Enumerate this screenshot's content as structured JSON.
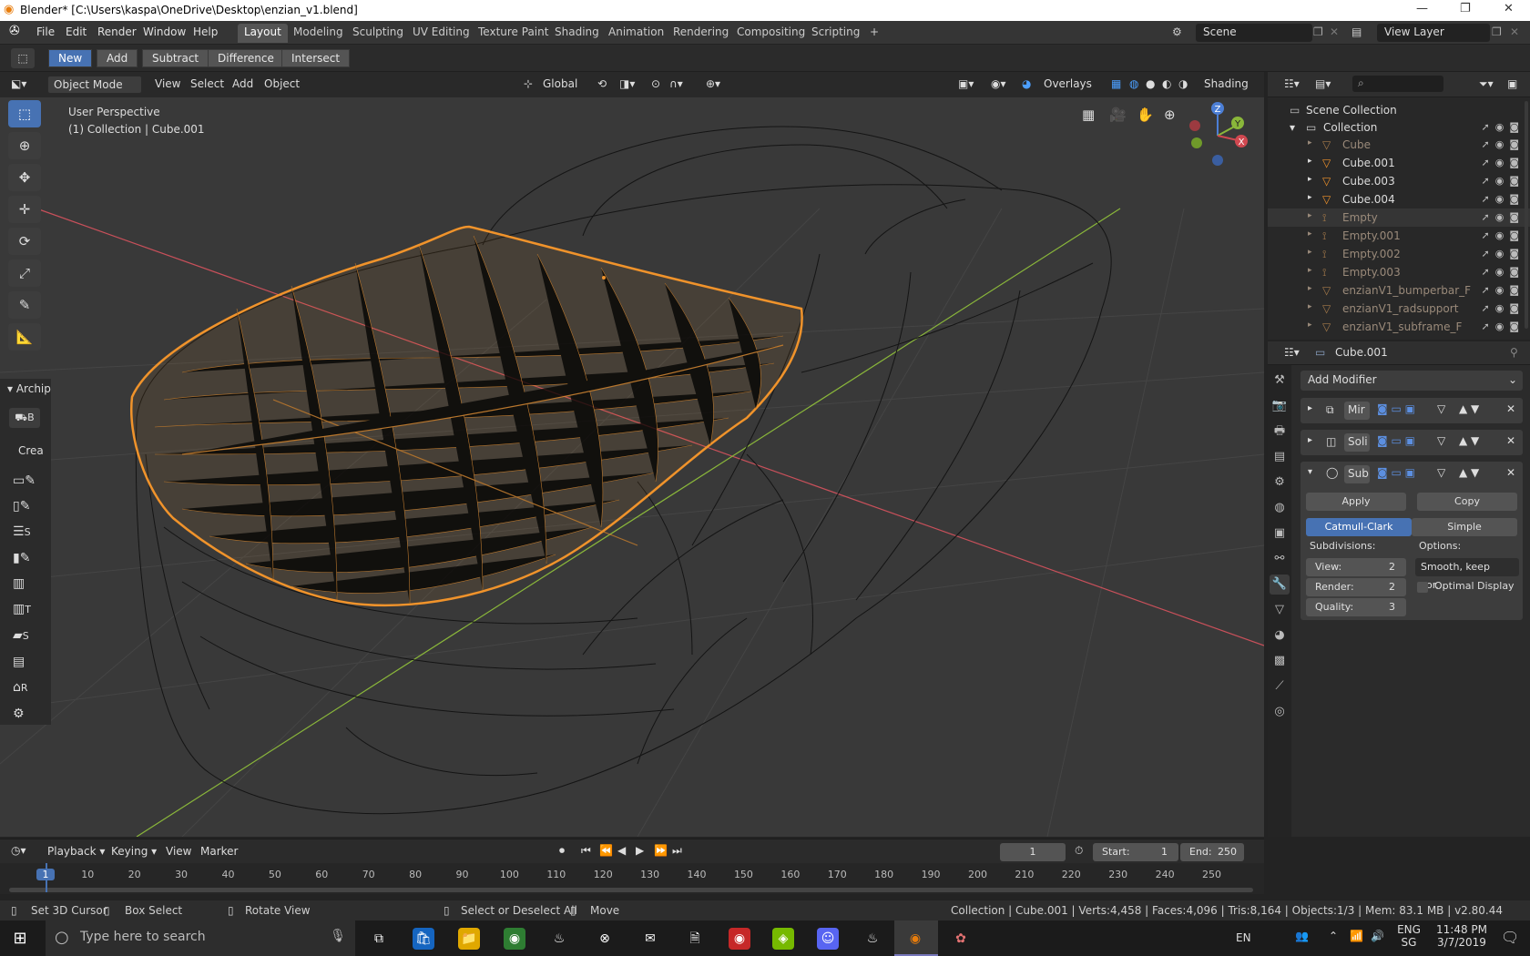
{
  "titlebar": {
    "title": "Blender* [C:\\Users\\kaspa\\OneDrive\\Desktop\\enzian_v1.blend]",
    "minimize": "—",
    "maximize": "❐",
    "close": "✕"
  },
  "menu": {
    "items": [
      "File",
      "Edit",
      "Render",
      "Window",
      "Help"
    ]
  },
  "workspaces": [
    "Layout",
    "Modeling",
    "Sculpting",
    "UV Editing",
    "Texture Paint",
    "Shading",
    "Animation",
    "Rendering",
    "Compositing",
    "Scripting"
  ],
  "workspace_add": "+",
  "scene": {
    "label": "Scene",
    "view_layer": "View Layer"
  },
  "boolean_header": {
    "new": "New",
    "add": "Add",
    "subtract": "Subtract",
    "difference": "Difference",
    "intersect": "Intersect"
  },
  "viewport": {
    "mode": "Object Mode",
    "menus": [
      "View",
      "Select",
      "Add",
      "Object"
    ],
    "transform": "Global",
    "overlays": "Overlays",
    "shading": "Shading",
    "perspective": "User Perspective",
    "collection_info": "(1) Collection | Cube.001",
    "gizmo": {
      "z": "Z",
      "y": "Y",
      "x": "X"
    },
    "archipack_label": "Archip",
    "create_label": "Crea",
    "archi_tools": [
      "B",
      "",
      "",
      "S",
      "",
      "",
      "T",
      "S",
      "",
      "R",
      ""
    ]
  },
  "outliner": {
    "scene_collection": "Scene Collection",
    "collection": "Collection",
    "rows": [
      {
        "name": "Cube",
        "dim": true
      },
      {
        "name": "Cube.001",
        "dim": false
      },
      {
        "name": "Cube.003",
        "dim": false
      },
      {
        "name": "Cube.004",
        "dim": false
      },
      {
        "name": "Empty",
        "dim": true
      },
      {
        "name": "Empty.001",
        "dim": true
      },
      {
        "name": "Empty.002",
        "dim": true
      },
      {
        "name": "Empty.003",
        "dim": true
      },
      {
        "name": "enzianV1_bumperbar_F",
        "dim": true
      },
      {
        "name": "enzianV1_radsupport",
        "dim": true
      },
      {
        "name": "enzianV1_subframe_F",
        "dim": true
      }
    ]
  },
  "properties": {
    "object": "Cube.001",
    "add_modifier": "Add Modifier",
    "modifiers": [
      {
        "name": "Mir"
      },
      {
        "name": "Soli"
      },
      {
        "name": "Sub"
      }
    ],
    "apply": "Apply",
    "copy": "Copy",
    "catmull": "Catmull-Clark",
    "simple": "Simple",
    "subdivisions": "Subdivisions:",
    "options": "Options:",
    "view_label": "View:",
    "view_value": "2",
    "render_label": "Render:",
    "render_value": "2",
    "quality_label": "Quality:",
    "quality_value": "3",
    "uv_smooth": "Smooth, keep cor...",
    "optimal_display": "Optimal Display"
  },
  "timeline": {
    "playback": "Playback",
    "keying": "Keying",
    "view": "View",
    "marker": "Marker",
    "current_frame": "1",
    "start_label": "Start:",
    "start": "1",
    "end_label": "End:",
    "end": "250",
    "ruler": [
      "1",
      "10",
      "20",
      "30",
      "40",
      "50",
      "60",
      "70",
      "80",
      "90",
      "100",
      "110",
      "120",
      "130",
      "140",
      "150",
      "160",
      "170",
      "180",
      "190",
      "200",
      "210",
      "220",
      "230",
      "240",
      "250"
    ]
  },
  "statusbar": {
    "set_cursor": "Set 3D Cursor",
    "box_select": "Box Select",
    "rotate_view": "Rotate View",
    "select_deselect": "Select or Deselect All",
    "move": "Move",
    "stats": "Collection | Cube.001 | Verts:4,458 | Faces:4,096 | Tris:8,164 | Objects:1/3 | Mem: 83.1 MB | v2.80.44"
  },
  "taskbar": {
    "search_placeholder": "Type here to search",
    "lang": "EN",
    "ime_top": "ENG",
    "ime_bottom": "SG",
    "time": "11:48 PM",
    "date": "3/7/2019"
  },
  "colors": {
    "accent": "#4772b3",
    "selection": "#f0932b",
    "x_axis": "#c8505a",
    "y_axis": "#8ab73a"
  }
}
